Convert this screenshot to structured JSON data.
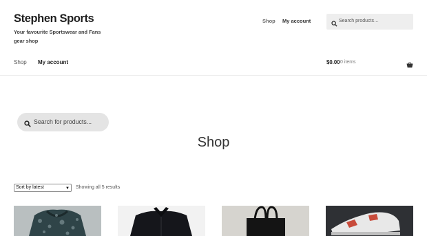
{
  "site": {
    "title": "Stephen Sports",
    "description": "Your favourite Sportswear and Fans gear shop"
  },
  "secondary_nav": {
    "shop": "Shop",
    "account": "My account"
  },
  "header_search": {
    "placeholder": "Search products…"
  },
  "primary_nav": {
    "shop": "Shop",
    "account": "My account"
  },
  "cart": {
    "amount": "$0.00",
    "items": "0 items"
  },
  "main_search": {
    "placeholder": "Search for products..."
  },
  "page": {
    "title": "Shop"
  },
  "catalog": {
    "sort_selected": "Sort by latest",
    "result_count": "Showing all 5 results"
  },
  "icons": {
    "search": "search-icon",
    "cart": "basket-icon",
    "dropdown": "chevron-down-icon"
  },
  "colors": {
    "text_dark": "#1f1f1f",
    "search_bg": "#eeeeee",
    "pill_bg": "#e4e4e4"
  }
}
